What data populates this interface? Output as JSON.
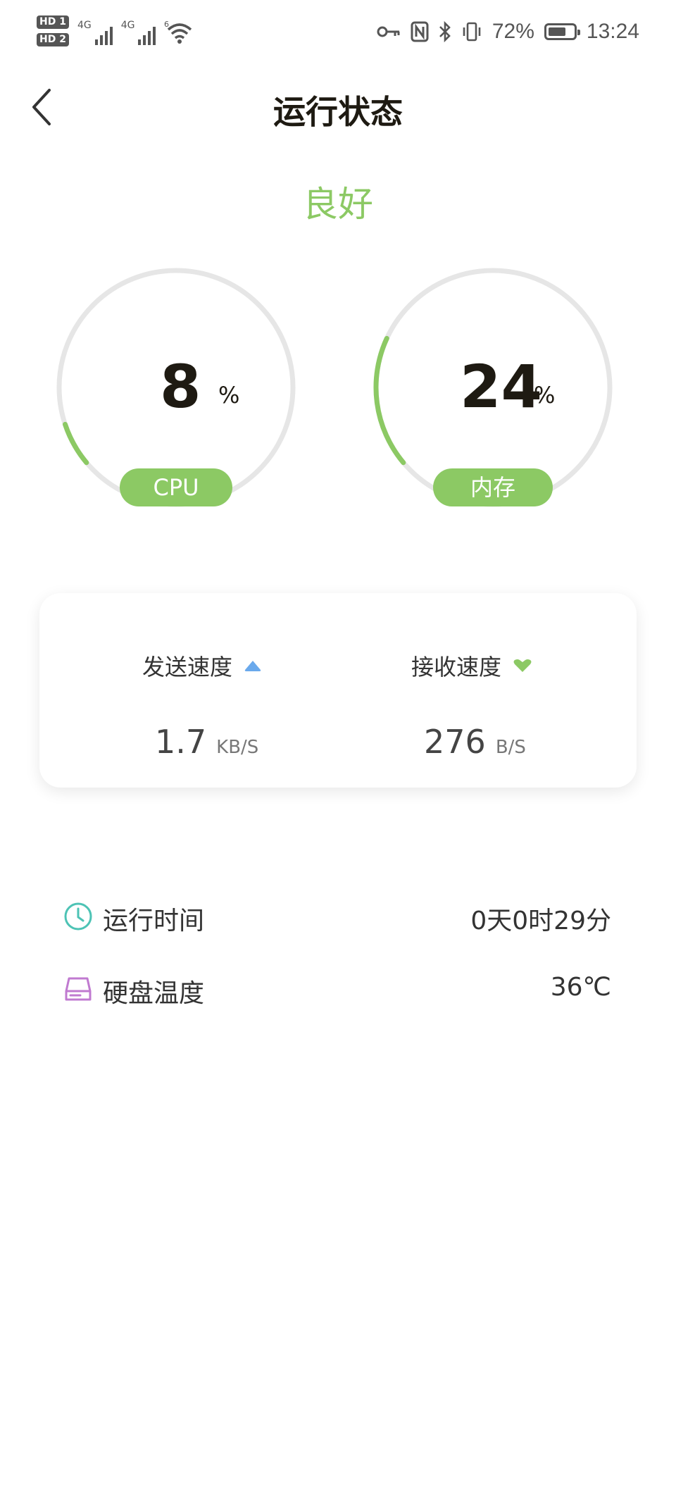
{
  "status_bar": {
    "hd1": "HD 1",
    "hd2": "HD 2",
    "net1": "4G",
    "net2": "4G",
    "wifi_badge": "6",
    "battery_percent": "72%",
    "battery_level": 0.72,
    "time": "13:24"
  },
  "header": {
    "title": "运行状态"
  },
  "health": {
    "status": "良好"
  },
  "gauges": {
    "cpu": {
      "value": "8",
      "unit": "%",
      "label": "CPU",
      "fraction": 0.08
    },
    "memory": {
      "value": "24",
      "unit": "%",
      "label": "内存",
      "fraction": 0.24
    }
  },
  "speeds": {
    "send": {
      "label": "发送速度",
      "value": "1.7",
      "unit": "KB/S",
      "icon": "upload-triangle-icon",
      "color": "#6aa9ec"
    },
    "receive": {
      "label": "接收速度",
      "value": "276",
      "unit": "B/S",
      "icon": "download-heart-icon",
      "color": "#8cc964"
    }
  },
  "info": {
    "uptime": {
      "label": "运行时间",
      "value": "0天0时29分",
      "icon": "clock-icon"
    },
    "disk_temp": {
      "label": "硬盘温度",
      "value": "36℃",
      "icon": "hard-disk-icon"
    }
  },
  "colors": {
    "accent": "#8cc964",
    "track": "#e6e6e6",
    "title": "#1e1a12"
  }
}
